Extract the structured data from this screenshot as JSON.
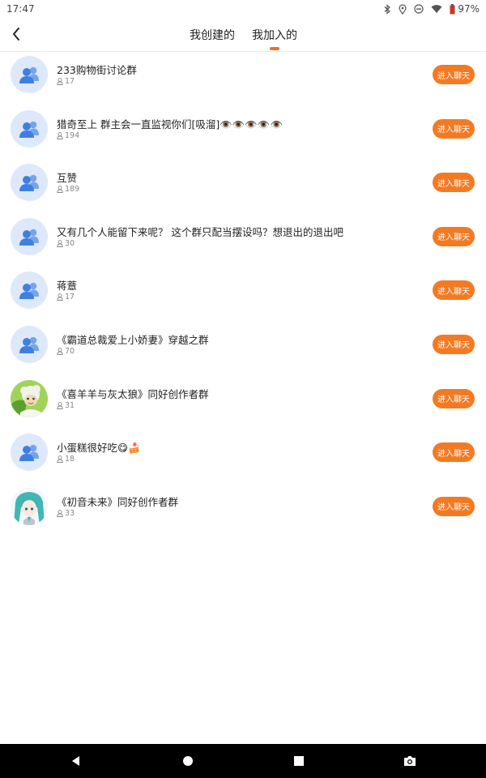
{
  "status_bar": {
    "time": "17:47",
    "battery": "97%",
    "icons": [
      "bluetooth-icon",
      "location-icon",
      "do-not-disturb-icon",
      "wifi-icon",
      "battery-icon"
    ]
  },
  "header": {
    "tabs": [
      {
        "label": "我创建的",
        "active": false
      },
      {
        "label": "我加入的",
        "active": true
      }
    ],
    "accent_color": "#f07020"
  },
  "groups": [
    {
      "name": "233购物街讨论群",
      "members": "17",
      "avatar": "default-group",
      "button": "进入聊天"
    },
    {
      "name": "猎奇至上 群主会一直监视你们[吸溜]👁️👁️👁️👁️👁️",
      "members": "194",
      "avatar": "default-group",
      "button": "进入聊天"
    },
    {
      "name": "互赞",
      "members": "189",
      "avatar": "default-group",
      "button": "进入聊天"
    },
    {
      "name": "又有几个人能留下来呢？ 这个群只配当摆设吗？想退出的退出吧",
      "members": "30",
      "avatar": "default-group",
      "button": "进入聊天"
    },
    {
      "name": "蒋薏",
      "members": "17",
      "avatar": "default-group",
      "button": "进入聊天"
    },
    {
      "name": "《霸道总裁爱上小娇妻》穿越之群",
      "members": "70",
      "avatar": "default-group",
      "button": "进入聊天"
    },
    {
      "name": "《喜羊羊与灰太狼》同好创作者群",
      "members": "31",
      "avatar": "sheep-image",
      "button": "进入聊天"
    },
    {
      "name": "小蛋糕很好吃😋🍰",
      "members": "18",
      "avatar": "default-group",
      "button": "进入聊天"
    },
    {
      "name": "《初音未来》同好创作者群",
      "members": "33",
      "avatar": "miku-image",
      "button": "进入聊天"
    }
  ],
  "colors": {
    "button_bg": "#f47a22",
    "avatar_bg": "#dde9fa",
    "avatar_icon": "#3f7fe0"
  },
  "nav_bar": {
    "buttons": [
      "back-triangle-icon",
      "home-circle-icon",
      "recents-square-icon",
      "camera-icon"
    ]
  }
}
